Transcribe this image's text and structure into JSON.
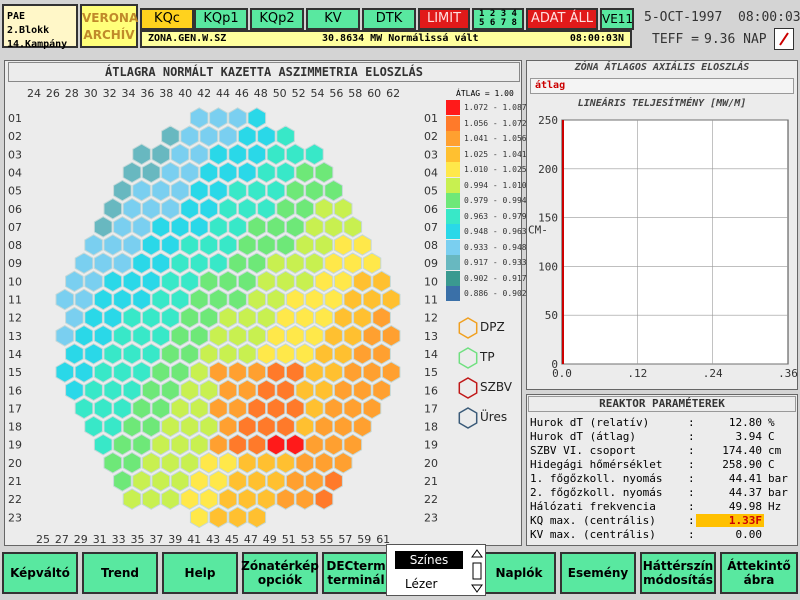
{
  "header": {
    "plant_line1": "PAE 2.Blokk",
    "plant_line2": "14.Kampány",
    "archive_line1": "VERONA",
    "archive_line2": "ARCHÍV",
    "tabs": [
      {
        "label": "KQc",
        "color": "#ffd21e"
      },
      {
        "label": "KQp1",
        "color": "#59e8a0"
      },
      {
        "label": "KQp2",
        "color": "#59e8a0"
      },
      {
        "label": "KV",
        "color": "#59e8a0"
      },
      {
        "label": "DTK",
        "color": "#59e8a0"
      },
      {
        "label": "LIMIT",
        "color": "#e11a1a"
      },
      {
        "label": "1 2 3 4 5 6 7 8",
        "color": "#59e8a0"
      },
      {
        "label": "ADAT ÁLL",
        "color": "#e11a1a"
      },
      {
        "label": "VE11",
        "color": "#59e8a0"
      }
    ],
    "status_zone": "ZONA.GEN.W.SZ",
    "status_message": "30.8634 MW Normálissá vált",
    "status_time": "08:00:03N",
    "date": "5-OCT-1997",
    "time": "08:00:03",
    "teff_label": "TEFF =",
    "teff_value": "9.36 NAP"
  },
  "map": {
    "title": "ÁTLAGRA NORMÁLT KAZETTA ASZIMMETRIA ELOSZLÁS",
    "top_cols": [
      "24",
      "26",
      "28",
      "30",
      "32",
      "34",
      "36",
      "38",
      "40",
      "42",
      "44",
      "46",
      "48",
      "50",
      "52",
      "54",
      "56",
      "58",
      "60",
      "62"
    ],
    "bottom_cols": [
      "25",
      "27",
      "29",
      "31",
      "33",
      "35",
      "37",
      "39",
      "41",
      "43",
      "45",
      "47",
      "49",
      "51",
      "53",
      "55",
      "57",
      "59",
      "61"
    ],
    "rows": [
      "01",
      "02",
      "03",
      "04",
      "05",
      "06",
      "07",
      "08",
      "09",
      "10",
      "11",
      "12",
      "13",
      "14",
      "15",
      "16",
      "17",
      "18",
      "19",
      "20",
      "21",
      "22",
      "23"
    ],
    "avg_label": "ÁTLAG =  1.00",
    "legend": [
      {
        "range": "1.072 - 1.087",
        "color": "#ff1a1a"
      },
      {
        "range": "1.056 - 1.072",
        "color": "#ff7a2a"
      },
      {
        "range": "1.041 - 1.056",
        "color": "#ffa030"
      },
      {
        "range": "1.025 - 1.041",
        "color": "#ffc030"
      },
      {
        "range": "1.010 - 1.025",
        "color": "#ffe84a"
      },
      {
        "range": "0.994 - 1.010",
        "color": "#c8f050"
      },
      {
        "range": "0.979 - 0.994",
        "color": "#6ee878"
      },
      {
        "range": "0.963 - 0.979",
        "color": "#38e8c8"
      },
      {
        "range": "0.948 - 0.963",
        "color": "#2ad8e8"
      },
      {
        "range": "0.933 - 0.948",
        "color": "#7acff0"
      },
      {
        "range": "0.917 - 0.933",
        "color": "#68b8c0"
      },
      {
        "range": "0.902 - 0.917",
        "color": "#3a9a90"
      },
      {
        "range": "0.886 - 0.902",
        "color": "#3a70a8"
      }
    ],
    "markers": [
      {
        "label": "DPZ",
        "color": "#f0a020"
      },
      {
        "label": "TP",
        "color": "#70e080"
      },
      {
        "label": "SZBV",
        "color": "#c01818"
      },
      {
        "label": "Üres",
        "color": "#3a5a78"
      }
    ]
  },
  "zone": {
    "title": "ZÓNA ÁTLAGOS AXIÁLIS ELOSZLÁS",
    "tab_label": "átlag",
    "chart_title": "LINEÁRIS TELJESÍTMÉNY [MW/M]",
    "y_unit": "CM",
    "y_ticks": [
      "250",
      "200",
      "150",
      "100",
      "50",
      "0"
    ],
    "x_ticks": [
      "0.0",
      ".12",
      ".24",
      ".36"
    ]
  },
  "reactor": {
    "title": "REAKTOR PARAMÉTEREK",
    "params": [
      {
        "name": "Hurok dT (relatív)",
        "value": "12.80",
        "unit": "%"
      },
      {
        "name": "Hurok dT (átlag)",
        "value": "3.94",
        "unit": "C"
      },
      {
        "name": "SZBV VI. csoport",
        "value": "174.40",
        "unit": "cm"
      },
      {
        "name": "Hidegági hőmérséklet",
        "value": "258.90",
        "unit": "C"
      },
      {
        "name": "1. főgőzkoll. nyomás",
        "value": "44.41",
        "unit": "bar"
      },
      {
        "name": "2. főgőzkoll. nyomás",
        "value": "44.37",
        "unit": "bar"
      },
      {
        "name": "Hálózati frekvencia",
        "value": "49.98",
        "unit": "Hz"
      },
      {
        "name": "KQ max. (centrális)",
        "value": "1.33F",
        "unit": ""
      },
      {
        "name": "KV max. (centrális)",
        "value": "0.00",
        "unit": ""
      }
    ]
  },
  "footer": {
    "buttons": [
      "Képváltó",
      "Trend",
      "Help",
      "Zónatérkép opciók",
      "DECterm terminál",
      "Naplók",
      "Esemény",
      "Háttérszín módosítás",
      "Áttekintő ábra"
    ],
    "popup_selected": "Színes",
    "popup_other": "Lézer"
  }
}
